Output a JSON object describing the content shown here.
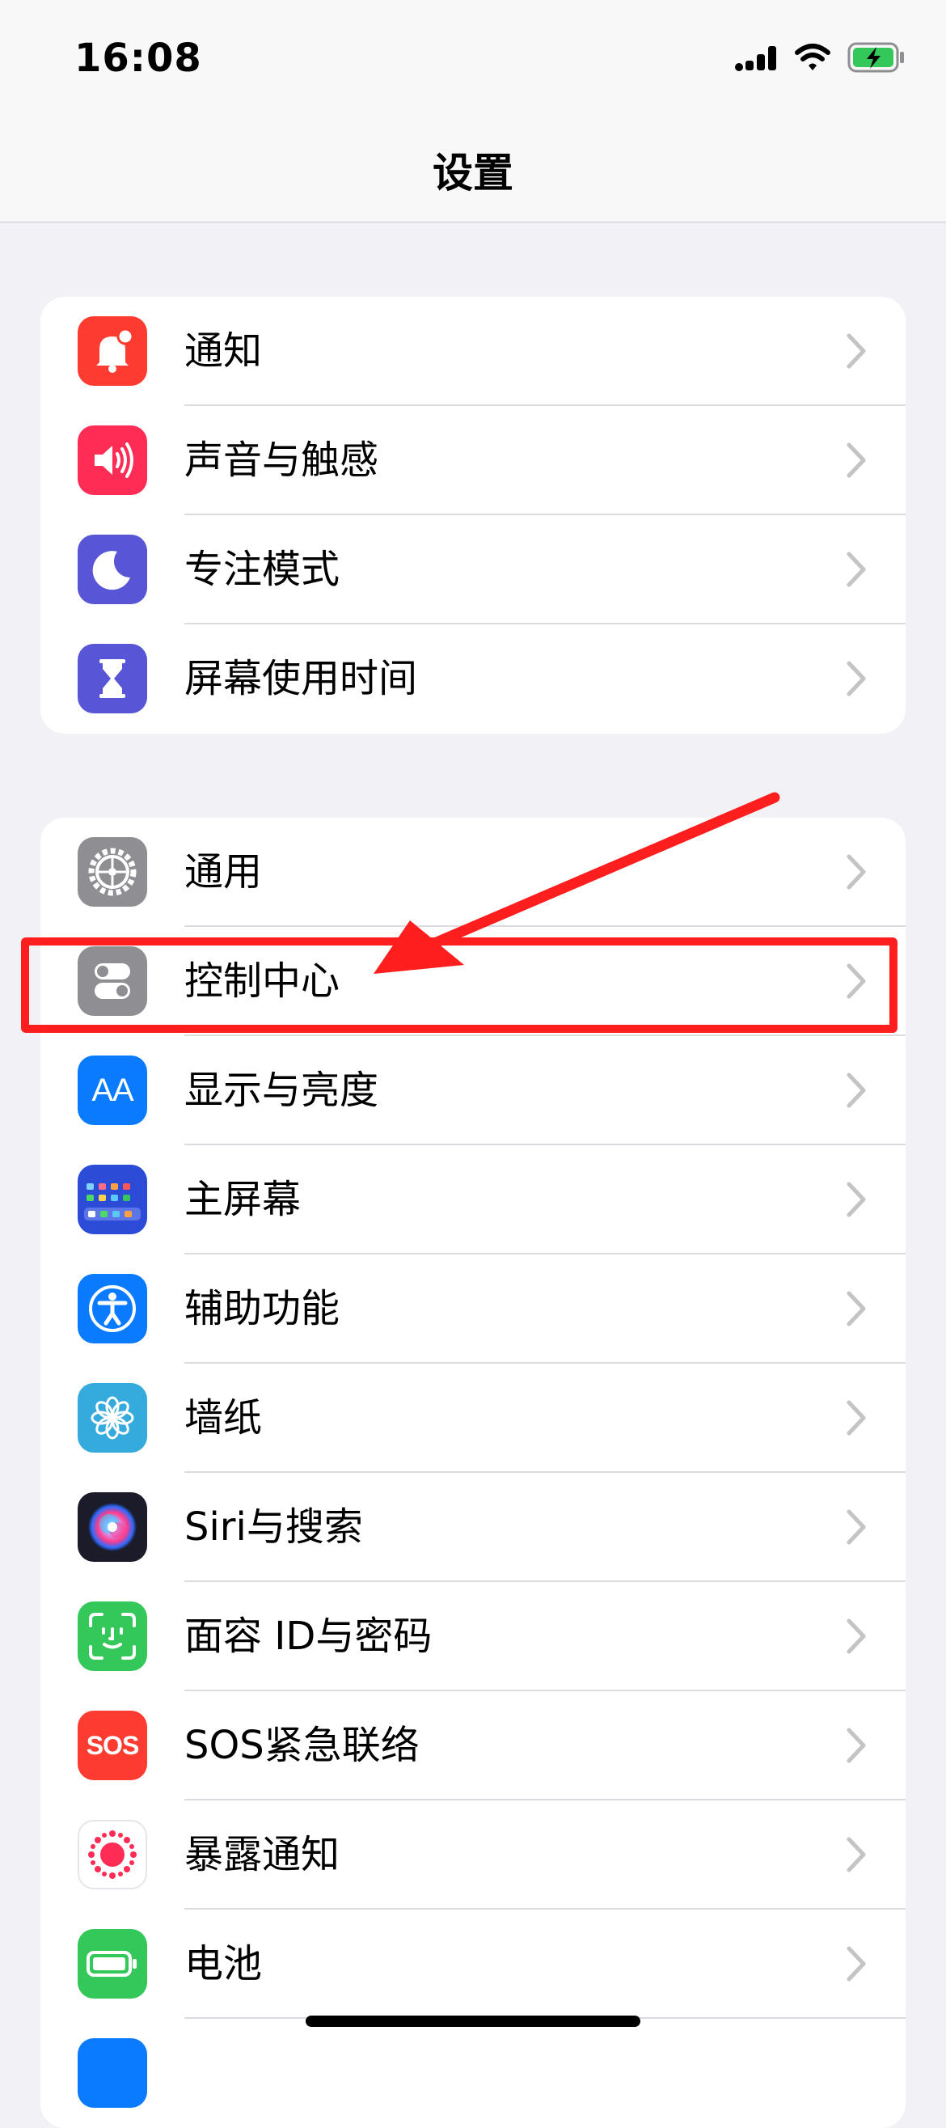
{
  "status_bar": {
    "time": "16:08",
    "battery_color": "#34c759"
  },
  "nav": {
    "title": "设置"
  },
  "group1": [
    {
      "label": "通知",
      "icon": "notification-bell-icon",
      "color": "#fe3b30"
    },
    {
      "label": "声音与触感",
      "icon": "speaker-icon",
      "color": "#ff2d55"
    },
    {
      "label": "专注模式",
      "icon": "moon-icon",
      "color": "#5856d6"
    },
    {
      "label": "屏幕使用时间",
      "icon": "hourglass-icon",
      "color": "#5856d6"
    }
  ],
  "group2": [
    {
      "label": "通用",
      "icon": "gear-icon",
      "color": "#8e8e93"
    },
    {
      "label": "控制中心",
      "icon": "toggle-switch-icon",
      "color": "#8e8e93"
    },
    {
      "label": "显示与亮度",
      "icon": "text-size-icon",
      "color": "#0a7aff",
      "icon_text": "AA"
    },
    {
      "label": "主屏幕",
      "icon": "app-grid-icon",
      "color": "#2c4bd6"
    },
    {
      "label": "辅助功能",
      "icon": "accessibility-icon",
      "color": "#0a7aff"
    },
    {
      "label": "墙纸",
      "icon": "flower-icon",
      "color": "#35aadc"
    },
    {
      "label": "Siri与搜索",
      "icon": "siri-orb-icon",
      "color": "#1b1b2a"
    },
    {
      "label": "面容 ID与密码",
      "icon": "face-id-icon",
      "color": "#34c759"
    },
    {
      "label": "SOS紧急联络",
      "icon": "sos-icon",
      "color": "#fe3b30",
      "icon_text": "SOS"
    },
    {
      "label": "暴露通知",
      "icon": "exposure-icon",
      "color": "#ffffff"
    },
    {
      "label": "电池",
      "icon": "battery-icon",
      "color": "#34c759"
    }
  ],
  "annotation": {
    "highlight_color": "#ff1e1e"
  }
}
